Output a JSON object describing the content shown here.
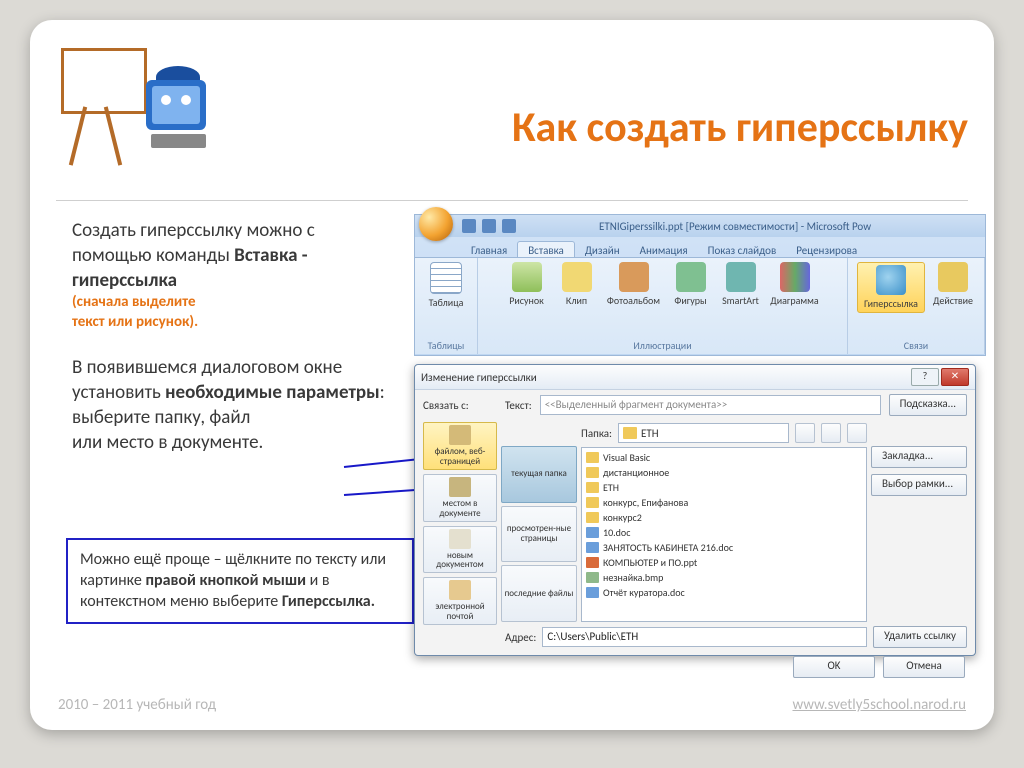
{
  "title": "Как создать гиперссылку",
  "para1_a": "Создать гиперссылку можно с помощью команды ",
  "para1_b": "Вставка  - гиперссылка",
  "para1_c1": "(сначала выделите",
  "para1_c2": "текст или рисунок).",
  "para2_a": "В появившемся диалоговом окне установить ",
  "para2_b": "необходимые параметры",
  "para2_c": ": выберите папку, файл",
  "para2_d": "или место в документе.",
  "tip_a": "Можно ещё проще – щёлкните по тексту или  картинке ",
  "tip_b": "правой кнопкой мыши",
  "tip_c": " и в контекстном меню выберите ",
  "tip_d": "Гиперссылка.",
  "footer_left": "2010 – 2011 учебный год",
  "footer_right": "www.svetly5school.narod.ru",
  "ribbon": {
    "window_title": "ETNIGiperssilki.ppt [Режим совместимости] - Microsoft Pow",
    "tabs": {
      "home": "Главная",
      "insert": "Вставка",
      "design": "Дизайн",
      "anim": "Анимация",
      "show": "Показ слайдов",
      "review": "Рецензирова"
    },
    "items": {
      "table": "Таблица",
      "picture": "Рисунок",
      "clip": "Клип",
      "album": "Фотоальбом",
      "shapes": "Фигуры",
      "smartart": "SmartArt",
      "chart": "Диаграмма",
      "hyperlink": "Гиперссылка",
      "action": "Действие"
    },
    "groups": {
      "tables": "Таблицы",
      "illus": "Иллюстрации",
      "links": "Связи"
    }
  },
  "dialog": {
    "title": "Изменение гиперссылки",
    "link_to": "Связать с:",
    "text_label": "Текст:",
    "text_placeholder": "<<Выделенный фрагмент документа>>",
    "hint_btn": "Подсказка...",
    "folder_label": "Папка:",
    "folder_value": "ETH",
    "nav": {
      "file": "файлом, веб-страницей",
      "place": "местом в документе",
      "newdoc": "новым документом",
      "mail": "электронной почтой"
    },
    "subtabs": {
      "current": "текущая папка",
      "viewed": "просмотрен-ные страницы",
      "recent": "последние файлы"
    },
    "files": [
      "Visual Basic",
      "дистанционное",
      "ETH",
      "конкурс, Епифанова",
      "конкурс2",
      "10.doc",
      "ЗАНЯТОСТЬ КАБИНЕТА   216.doc",
      "КОМПЬЮТЕР и ПО.ppt",
      "незнайка.bmp",
      "Отчёт куратора.doc"
    ],
    "side": {
      "bookmark": "Закладка...",
      "frame": "Выбор рамки..."
    },
    "addr_label": "Адрес:",
    "addr_value": "C:\\Users\\Public\\ETH",
    "remove": "Удалить ссылку",
    "ok": "OK",
    "cancel": "Отмена"
  }
}
